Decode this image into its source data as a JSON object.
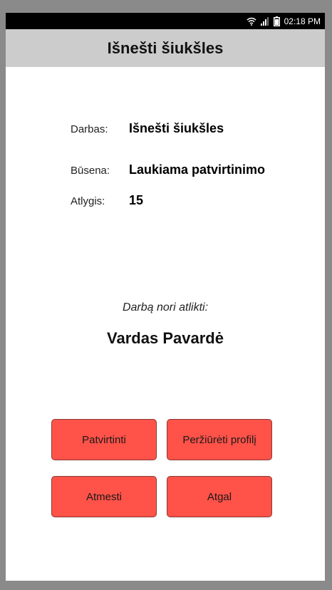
{
  "status_bar": {
    "time": "02:18 PM",
    "icons": [
      "wifi-icon",
      "signal-icon",
      "battery-icon"
    ]
  },
  "header": {
    "title": "Išnešti šiukšles"
  },
  "details": {
    "job_label": "Darbas:",
    "job_value": "Išnešti šiukšles",
    "status_label": "Būsena:",
    "status_value": "Laukiama patvirtinimo",
    "reward_label": "Atlygis:",
    "reward_value": "15"
  },
  "requester": {
    "label": "Darbą nori atlikti:",
    "name": "Vardas Pavardė"
  },
  "buttons": {
    "confirm": "Patvirtinti",
    "view_profile": "Peržiūrėti profilį",
    "reject": "Atmesti",
    "back": "Atgal"
  },
  "colors": {
    "button_bg": "#ff5248",
    "header_bg": "#cccccc",
    "status_bar_bg": "#000000"
  }
}
